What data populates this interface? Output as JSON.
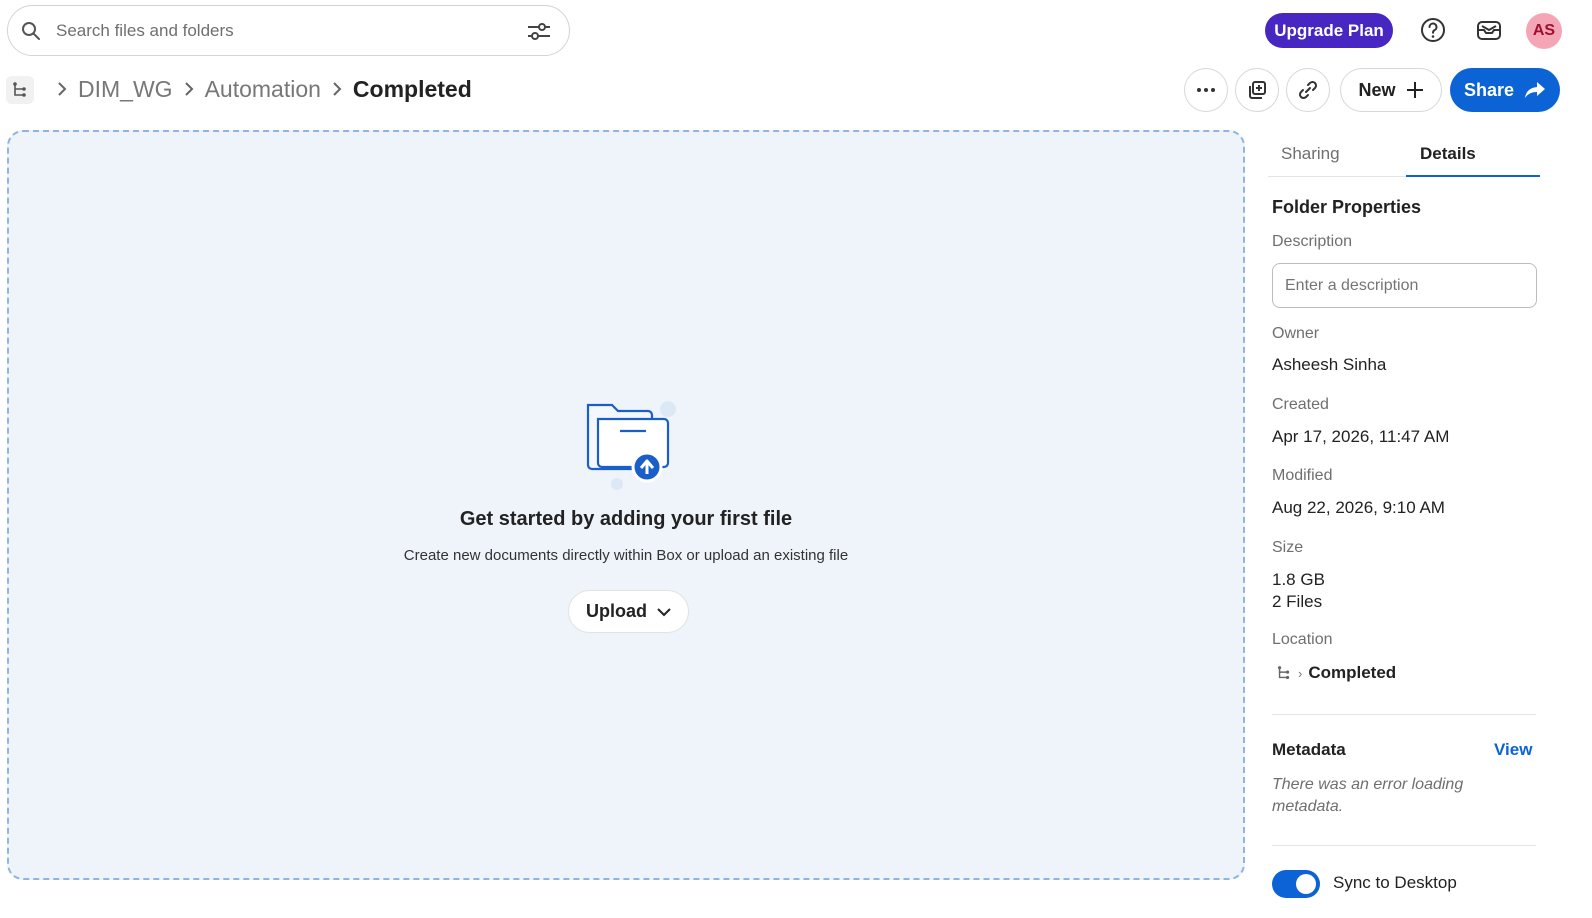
{
  "search": {
    "placeholder": "Search files and folders"
  },
  "header": {
    "upgrade_label": "Upgrade Plan",
    "avatar_initials": "AS"
  },
  "breadcrumb": {
    "items": [
      "DIM_WG",
      "Automation"
    ],
    "current": "Completed"
  },
  "toolbar": {
    "new_label": "New",
    "share_label": "Share"
  },
  "empty_state": {
    "title": "Get started by adding your first file",
    "subtitle": "Create new documents directly within Box or upload an existing file",
    "upload_label": "Upload"
  },
  "panel": {
    "tabs": [
      "Sharing",
      "Details"
    ],
    "active_tab": "Details",
    "heading": "Folder Properties",
    "description_label": "Description",
    "description_placeholder": "Enter a description",
    "owner_label": "Owner",
    "owner": "Asheesh Sinha",
    "created_label": "Created",
    "created": "Apr 17, 2026, 11:47 AM",
    "modified_label": "Modified",
    "modified": "Aug 22, 2026, 9:10 AM",
    "size_label": "Size",
    "size": "1.8 GB",
    "file_count": "2 Files",
    "location_label": "Location",
    "location_sep": "›",
    "location": "Completed",
    "metadata_heading": "Metadata",
    "metadata_view": "View",
    "metadata_error": "There was an error loading metadata.",
    "sync_label": "Sync to Desktop",
    "sync_enabled": true
  },
  "colors": {
    "accent": "#0b63d6",
    "upgrade": "#4826c2",
    "dropzone_bg": "#eff4fb"
  },
  "icons": [
    "search-icon",
    "filter-icon",
    "help-icon",
    "inbox-icon",
    "folder-tree-icon",
    "chevron-right-icon",
    "more-icon",
    "copy-icon",
    "link-icon",
    "plus-icon",
    "share-arrow-icon",
    "folder-upload-icon",
    "chevron-down-icon"
  ]
}
